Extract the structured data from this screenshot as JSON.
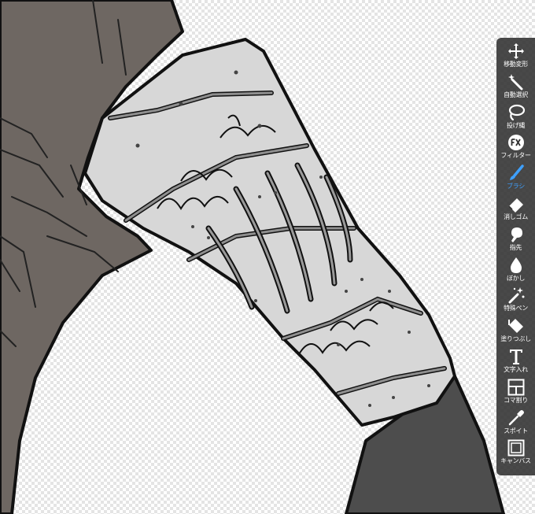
{
  "app": {
    "active_tool": "brush"
  },
  "colors": {
    "accent": "#3ea0ff",
    "toolbar_bg": "#303030",
    "toolbar_text": "#ffffff",
    "cloak": "#6e6762",
    "sleeve": "#4d4d4d",
    "bracer": "#d7d7d7",
    "bracer_groove": "#8f8f8f",
    "outline": "#111111"
  },
  "toolbar": {
    "tools": [
      {
        "id": "move",
        "icon": "move-arrows-icon",
        "label": "移動変形"
      },
      {
        "id": "magic",
        "icon": "magic-wand-icon",
        "label": "自動選択"
      },
      {
        "id": "lasso",
        "icon": "lasso-icon",
        "label": "投げ縄"
      },
      {
        "id": "filter",
        "icon": "fx-icon",
        "label": "フィルター"
      },
      {
        "id": "brush",
        "icon": "brush-icon",
        "label": "ブラシ"
      },
      {
        "id": "eraser",
        "icon": "eraser-icon",
        "label": "消しゴム"
      },
      {
        "id": "finger",
        "icon": "finger-smudge-icon",
        "label": "指先"
      },
      {
        "id": "blur",
        "icon": "blur-drop-icon",
        "label": "ぼかし"
      },
      {
        "id": "special",
        "icon": "special-pen-icon",
        "label": "特殊ペン"
      },
      {
        "id": "fill",
        "icon": "bucket-fill-icon",
        "label": "塗りつぶし"
      },
      {
        "id": "text",
        "icon": "text-icon",
        "label": "文字入れ"
      },
      {
        "id": "frame",
        "icon": "frame-divider-icon",
        "label": "コマ割り"
      },
      {
        "id": "dropper",
        "icon": "eyedropper-icon",
        "label": "スポイト"
      },
      {
        "id": "canvas",
        "icon": "canvas-icon",
        "label": "キャンバス"
      }
    ]
  }
}
